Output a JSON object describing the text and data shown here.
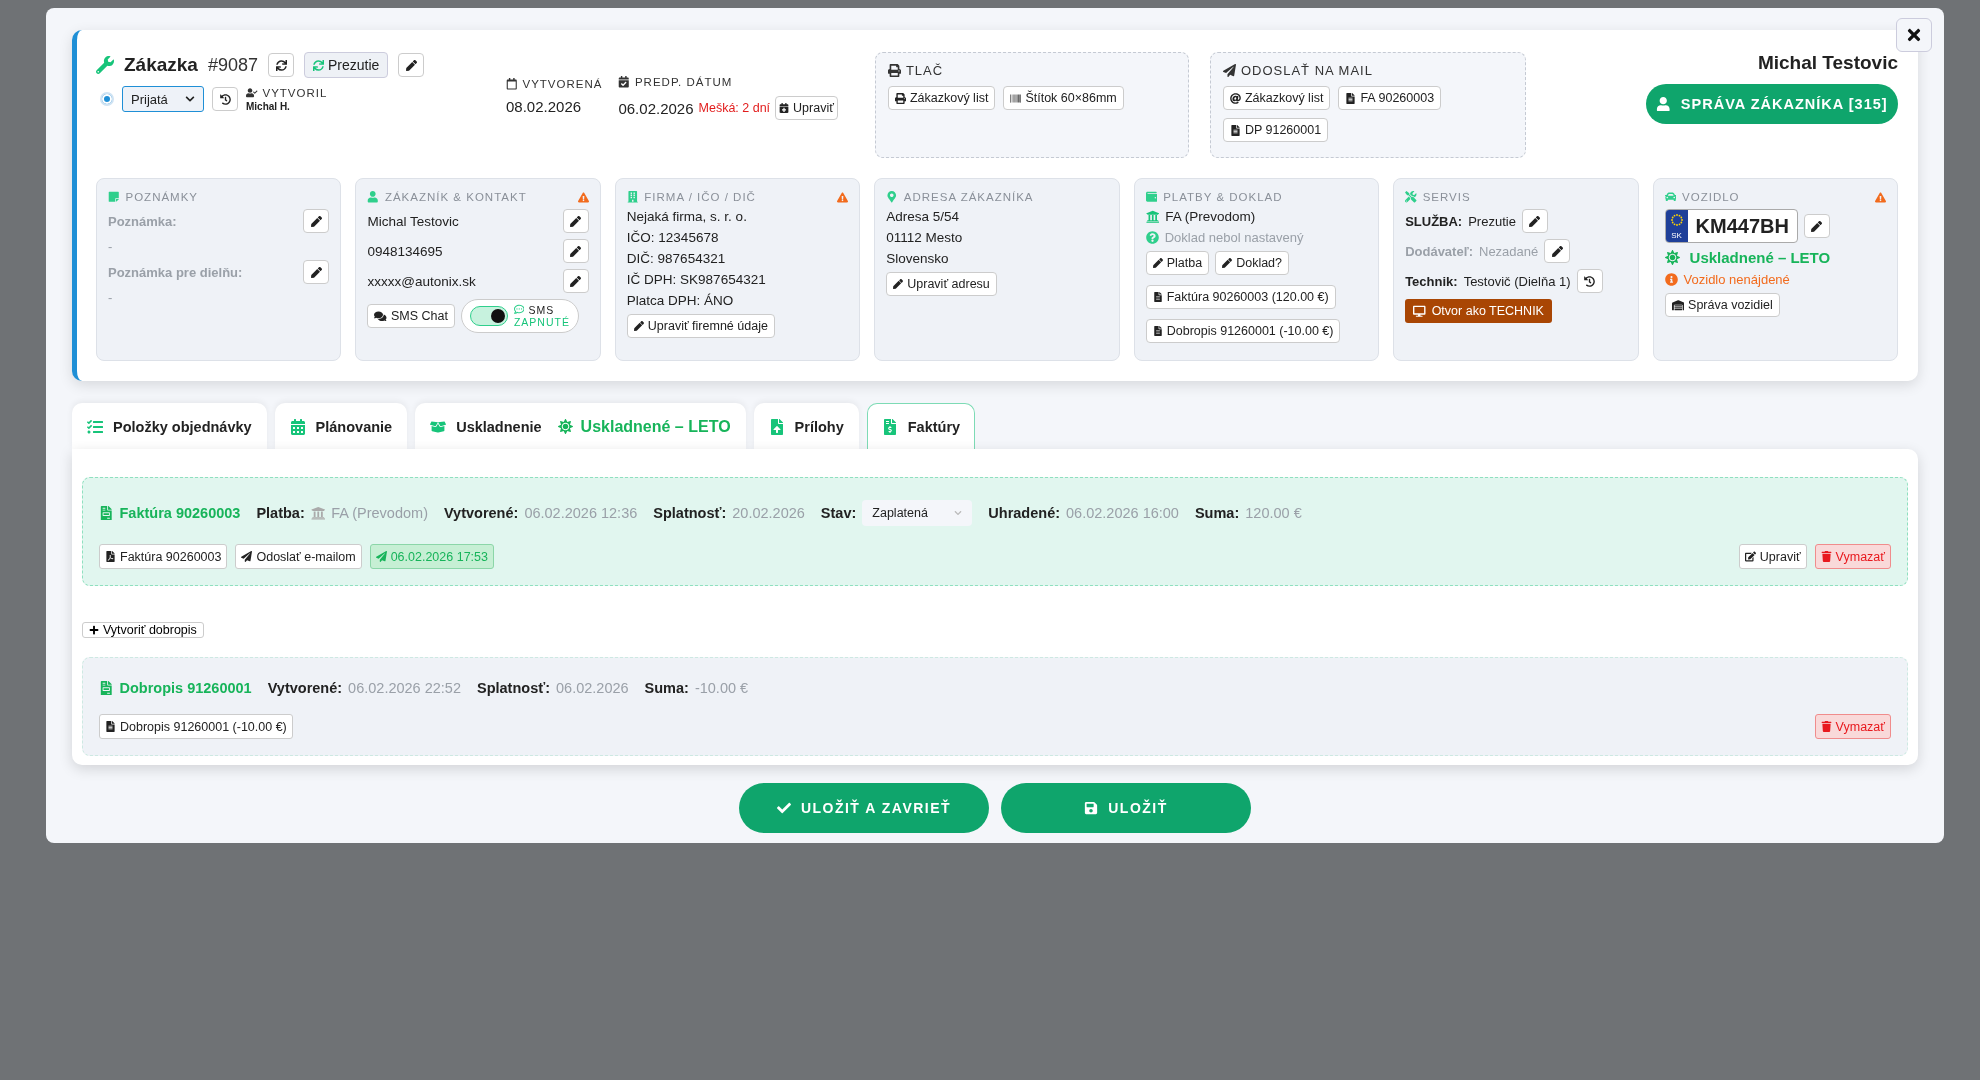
{
  "order": {
    "title": "Zákazka",
    "number": "#9087",
    "service_button": "Prezutie",
    "status_dot": {
      "checked": true
    },
    "status": "Prijatá",
    "created_by": {
      "label": "VYTVORIL",
      "name": "Michal H."
    },
    "created": {
      "label": "VYTVORENÁ",
      "date": "08.02.2026"
    },
    "due": {
      "label": "PREDP. DÁTUM",
      "date": "06.02.2026",
      "overdue": "Mešká: 2 dní",
      "button": "Upraviť"
    }
  },
  "print": {
    "title": "TLAČ",
    "buttons": [
      {
        "kind": "print",
        "label": "Zákazkový list"
      },
      {
        "kind": "barcode",
        "label": "Štítok 60×86mm"
      }
    ]
  },
  "mail": {
    "title": "ODOSLAŤ NA MAIL",
    "buttons": [
      {
        "kind": "at",
        "label": "Zákazkový list"
      },
      {
        "kind": "file",
        "label": "FA 90260003"
      },
      {
        "kind": "file",
        "label": "DP 91260001"
      }
    ]
  },
  "customer": {
    "name": "Michal Testovic",
    "button": "SPRÁVA ZÁKAZNÍKA [315]"
  },
  "cards": [
    {
      "kind": "notes",
      "title": "POZNÁMKY",
      "warning": false,
      "fields": [
        {
          "label": "Poznámka:",
          "value": "-"
        },
        {
          "label": "Poznámka pre dielňu:",
          "value": "-"
        }
      ]
    },
    {
      "kind": "contact",
      "title": "ZÁKAZNÍK & KONTAKT",
      "warning": true,
      "lines": [
        "Michal Testovic",
        "0948134695",
        "xxxxx@autonix.sk"
      ],
      "sms_chat": "SMS Chat",
      "sms_toggle": {
        "on": true,
        "label": "SMS",
        "state": "ZAPNUTÉ"
      }
    },
    {
      "kind": "company",
      "title": "FIRMA / IČO / DIČ",
      "warning": true,
      "lines": [
        "Nejaká firma, s. r. o.",
        "IČO: 12345678",
        "DIČ: 987654321",
        "IČ DPH: SK987654321",
        "Platca DPH: ÁNO"
      ],
      "button": "Upraviť firemné údaje"
    },
    {
      "kind": "address",
      "title": "ADRESA ZÁKAZNÍKA",
      "warning": false,
      "lines": [
        "Adresa 5/54",
        "01112 Mesto",
        "Slovensko"
      ],
      "button": "Upraviť adresu"
    },
    {
      "kind": "payments",
      "title": "PLATBY & DOKLAD",
      "warning": false,
      "method": "FA (Prevodom)",
      "doc_status": "Doklad nebol nastavený",
      "buttons": [
        "Platba",
        "Doklad?"
      ],
      "documents": [
        "Faktúra 90260003 (120.00 €)",
        "Dobropis 91260001 (-10.00 €)"
      ]
    },
    {
      "kind": "service",
      "title": "SERVIS",
      "warning": false,
      "rows": [
        {
          "label": "SLUŽBA:",
          "value": "Prezutie",
          "muted": false,
          "kind": "edit"
        },
        {
          "label": "Dodávateľ:",
          "value": "Nezadané",
          "muted": true,
          "kind": "edit"
        },
        {
          "label": "Technik:",
          "value": "Testovič (Dielňa 1)",
          "muted": false,
          "kind": "history"
        }
      ],
      "button": "Otvor ako TECHNIK"
    },
    {
      "kind": "vehicle",
      "title": "VOZIDLO",
      "warning": true,
      "plate": {
        "country": "SK",
        "number": "KM447BH"
      },
      "storage": "Uskladnené – LETO",
      "notice": "Vozidlo nenájdené",
      "button": "Správa vozidiel"
    }
  ],
  "tabs": [
    {
      "kind": "items",
      "label": "Položky objednávky",
      "selected": false
    },
    {
      "kind": "planning",
      "label": "Plánovanie",
      "selected": false
    },
    {
      "kind": "storage",
      "label": "Uskladnenie",
      "badge": "Uskladnené – LETO",
      "selected": false
    },
    {
      "kind": "attachments",
      "label": "Prílohy",
      "selected": false
    },
    {
      "kind": "invoices",
      "label": "Faktúry",
      "selected": true
    }
  ],
  "documents": [
    {
      "kind": "invoice",
      "title": "Faktúra 90260003",
      "fields": [
        {
          "kind": "bank",
          "label": "Platba:",
          "value": "FA (Prevodom)"
        },
        {
          "kind": "text",
          "label": "Vytvorené:",
          "value": "06.02.2026 12:36"
        },
        {
          "kind": "text",
          "label": "Splatnosť:",
          "value": "20.02.2026"
        },
        {
          "kind": "select",
          "label": "Stav:",
          "value": "Zaplatená"
        },
        {
          "kind": "text",
          "label": "Uhradené:",
          "value": "06.02.2026 16:00"
        },
        {
          "kind": "text",
          "label": "Suma:",
          "value": "120.00 €"
        }
      ],
      "actions": [
        {
          "kind": "pdf",
          "label": "Faktúra 90260003"
        },
        {
          "kind": "email",
          "label": "Odoslať e-mailom"
        },
        {
          "kind": "sent",
          "label": "06.02.2026 17:53"
        }
      ],
      "right_actions": [
        {
          "kind": "edit",
          "label": "Upraviť"
        },
        {
          "kind": "delete",
          "label": "Vymazať"
        }
      ]
    },
    {
      "kind": "create",
      "label": "Vytvoriť dobropis"
    },
    {
      "kind": "credit",
      "title": "Dobropis 91260001",
      "fields": [
        {
          "kind": "text",
          "label": "Vytvorené:",
          "value": "06.02.2026 22:52"
        },
        {
          "kind": "text",
          "label": "Splatnosť:",
          "value": "06.02.2026"
        },
        {
          "kind": "text",
          "label": "Suma:",
          "value": "-10.00 €"
        }
      ],
      "actions": [
        {
          "kind": "doc",
          "label": "Dobropis 91260001 (-10.00 €)"
        }
      ],
      "right_actions": [
        {
          "kind": "delete",
          "label": "Vymazať"
        }
      ]
    }
  ],
  "footer": [
    {
      "kind": "check",
      "label": "ULOŽIŤ A ZAVRIEŤ"
    },
    {
      "kind": "save",
      "label": "ULOŽIŤ"
    }
  ]
}
